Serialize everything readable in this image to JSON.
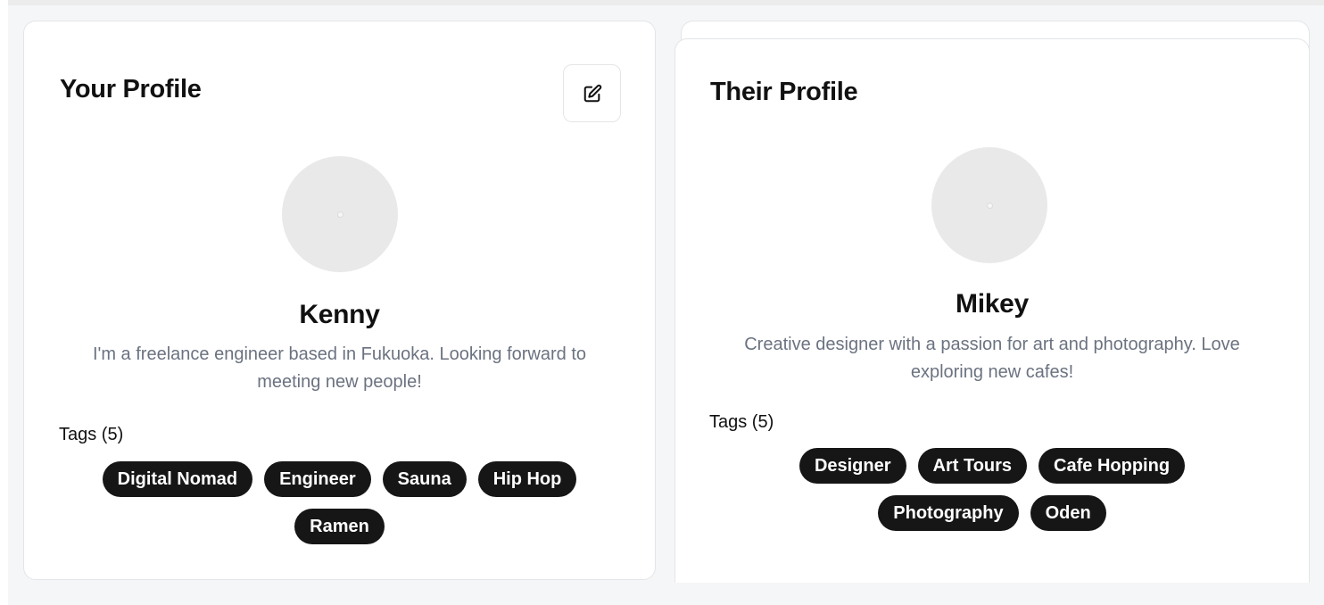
{
  "your_profile": {
    "title": "Your Profile",
    "name": "Kenny",
    "bio": "I'm a freelance engineer based in Fukuoka. Looking forward to meeting new people!",
    "tags_label": "Tags (5)",
    "tags": [
      "Digital Nomad",
      "Engineer",
      "Sauna",
      "Hip Hop",
      "Ramen"
    ],
    "edit_icon": "edit-icon"
  },
  "their_profile": {
    "title": "Their Profile",
    "name": "Mikey",
    "bio": "Creative designer with a passion for art and photography. Love exploring new cafes!",
    "tags_label": "Tags (5)",
    "tags": [
      "Designer",
      "Art Tours",
      "Cafe Hopping",
      "Photography",
      "Oden"
    ]
  },
  "colors": {
    "background": "#f5f6f7",
    "card": "#ffffff",
    "tag_bg": "#161616",
    "tag_text": "#ffffff",
    "muted_text": "#6b7280"
  }
}
